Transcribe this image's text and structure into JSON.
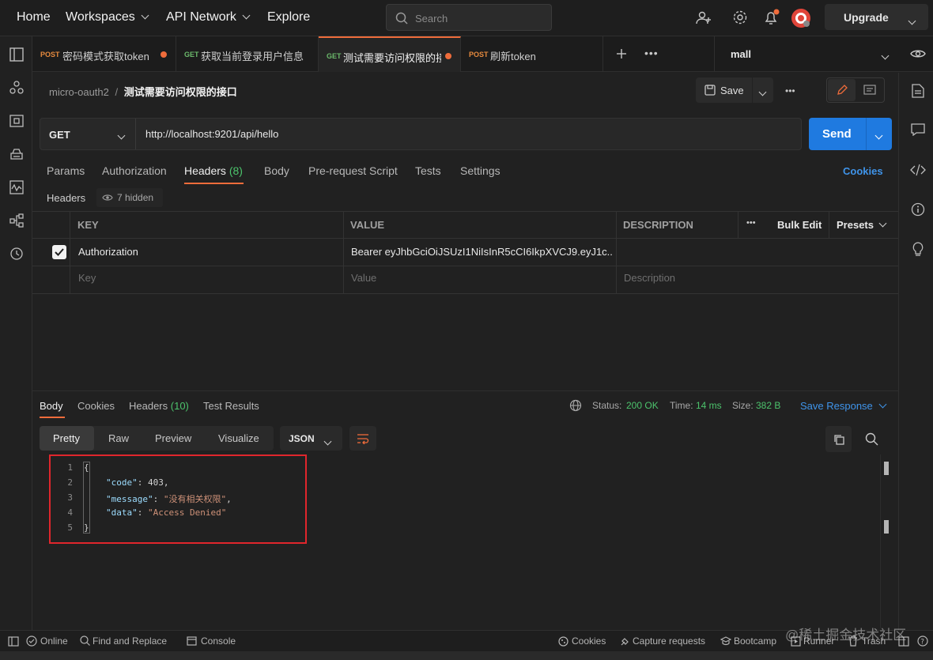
{
  "topnav": {
    "home": "Home",
    "workspaces": "Workspaces",
    "api_network": "API Network",
    "explore": "Explore",
    "search_placeholder": "Search",
    "upgrade": "Upgrade"
  },
  "tabs": [
    {
      "method": "POST",
      "title": "密码模式获取token",
      "unsaved": true
    },
    {
      "method": "GET",
      "title": "获取当前登录用户信息",
      "unsaved": false
    },
    {
      "method": "GET",
      "title": "测试需要访问权限的接口",
      "unsaved": true,
      "active": true
    },
    {
      "method": "POST",
      "title": "刷新token",
      "unsaved": false
    }
  ],
  "environment": "mall",
  "breadcrumb": {
    "collection": "micro-oauth2",
    "separator": "/",
    "request": "测试需要访问权限的接口"
  },
  "save_label": "Save",
  "request": {
    "method": "GET",
    "url": "http://localhost:9201/api/hello",
    "send_label": "Send"
  },
  "request_tabs": {
    "params": "Params",
    "authorization": "Authorization",
    "headers": "Headers",
    "headers_count": "(8)",
    "body": "Body",
    "prerequest": "Pre-request Script",
    "tests": "Tests",
    "settings": "Settings",
    "cookies": "Cookies"
  },
  "headers_section": {
    "label": "Headers",
    "hidden": "7 hidden"
  },
  "headers_table": {
    "columns": [
      "KEY",
      "VALUE",
      "DESCRIPTION"
    ],
    "bulk_edit": "Bulk Edit",
    "presets": "Presets",
    "rows": [
      {
        "checked": true,
        "key": "Authorization",
        "value": "Bearer eyJhbGciOiJSUzI1NiIsInR5cCI6IkpXVCJ9.eyJ1c..."
      }
    ],
    "placeholders": {
      "key": "Key",
      "value": "Value",
      "description": "Description"
    }
  },
  "response": {
    "tabs": {
      "body": "Body",
      "cookies": "Cookies",
      "headers": "Headers",
      "headers_count": "(10)",
      "test_results": "Test Results"
    },
    "status_label": "Status:",
    "status": "200 OK",
    "time_label": "Time:",
    "time": "14 ms",
    "size_label": "Size:",
    "size": "382 B",
    "save_response": "Save Response",
    "view_modes": [
      "Pretty",
      "Raw",
      "Preview",
      "Visualize"
    ],
    "format": "JSON",
    "code_lines": [
      "1",
      "2",
      "3",
      "4",
      "5"
    ],
    "json": {
      "open": "{",
      "code_key": "\"code\"",
      "code_val": "403",
      "message_key": "\"message\"",
      "message_val": "\"没有相关权限\"",
      "data_key": "\"data\"",
      "data_val": "\"Access Denied\"",
      "close": "}"
    }
  },
  "footer": {
    "online": "Online",
    "find_replace": "Find and Replace",
    "console": "Console",
    "cookies": "Cookies",
    "capture": "Capture requests",
    "bootcamp": "Bootcamp",
    "runner": "Runner",
    "trash": "Trash",
    "watermark": "@稀土掘金技术社区"
  },
  "colors": {
    "accent_orange": "#ef6c3b",
    "send_blue": "#1f7ae0",
    "status_green": "#4cc36c",
    "link_blue": "#3f94ea"
  }
}
